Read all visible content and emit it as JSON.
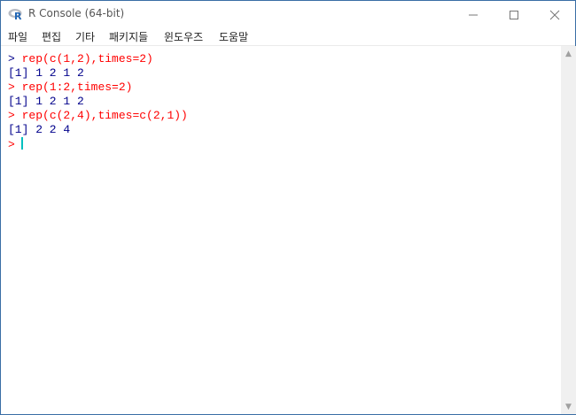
{
  "window": {
    "title": "R Console (64-bit)"
  },
  "menu": [
    "파일",
    "편집",
    "기타",
    "패키지들",
    "윈도우즈",
    "도움말"
  ],
  "console": {
    "lines": [
      {
        "prompt": ">",
        "text": "rep(c(1,2),times=2)"
      },
      {
        "output": "[1] 1 2 1 2"
      },
      {
        "prompt": ">",
        "text": "rep(1:2,times=2)"
      },
      {
        "output": "[1] 1 2 1 2"
      },
      {
        "prompt": ">",
        "text": "rep(c(2,4),times=c(2,1))"
      },
      {
        "output": "[1] 2 2 4"
      }
    ],
    "current_prompt": ">"
  },
  "colors": {
    "input": "#ff0000",
    "output": "#00008b",
    "cursor": "#00c0c0"
  }
}
